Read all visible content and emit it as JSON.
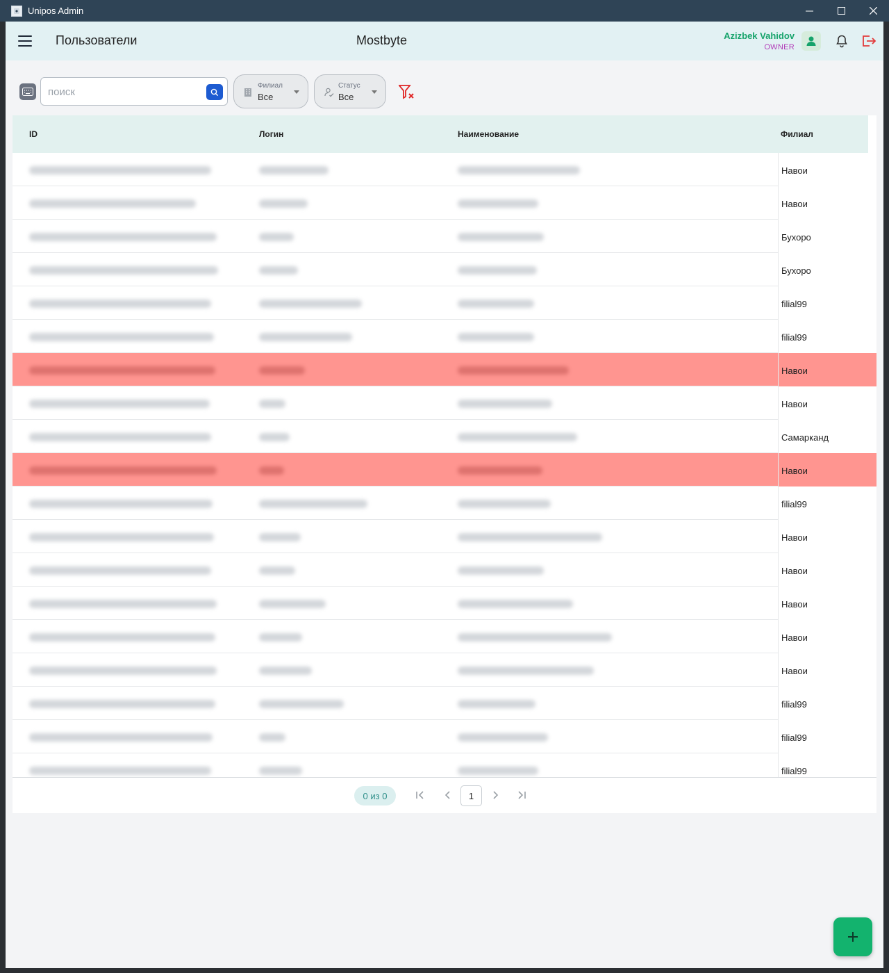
{
  "window": {
    "title": "Unipos Admin"
  },
  "header": {
    "page_title": "Пользователи",
    "company": "Mostbyte",
    "user_name": "Azizbek Vahidov",
    "user_role": "OWNER"
  },
  "toolbar": {
    "search_placeholder": "поиск",
    "branch_filter": {
      "label": "Филиал",
      "value": "Все"
    },
    "status_filter": {
      "label": "Статус",
      "value": "Все"
    }
  },
  "table": {
    "columns": [
      "ID",
      "Логин",
      "Наименование",
      "Филиал"
    ],
    "rows": [
      {
        "branch": "Навои",
        "highlighted": false
      },
      {
        "branch": "Навои",
        "highlighted": false
      },
      {
        "branch": "Бухоро",
        "highlighted": false
      },
      {
        "branch": "Бухоро",
        "highlighted": false
      },
      {
        "branch": "filial99",
        "highlighted": false
      },
      {
        "branch": "filial99",
        "highlighted": false
      },
      {
        "branch": "Навои",
        "highlighted": true
      },
      {
        "branch": "Навои",
        "highlighted": false
      },
      {
        "branch": "Самарканд",
        "highlighted": false
      },
      {
        "branch": "Навои",
        "highlighted": true
      },
      {
        "branch": "filial99",
        "highlighted": false
      },
      {
        "branch": "Навои",
        "highlighted": false
      },
      {
        "branch": "Навои",
        "highlighted": false
      },
      {
        "branch": "Навои",
        "highlighted": false
      },
      {
        "branch": "Навои",
        "highlighted": false
      },
      {
        "branch": "Навои",
        "highlighted": false
      },
      {
        "branch": "filial99",
        "highlighted": false
      },
      {
        "branch": "filial99",
        "highlighted": false
      },
      {
        "branch": "filial99",
        "highlighted": false
      }
    ]
  },
  "pagination": {
    "count": "0 из 0",
    "current_page": "1"
  },
  "colors": {
    "accent": "#13b36e",
    "highlight_row": "#ff9590",
    "header_bg": "#e2f1f3"
  },
  "icons": [
    "app-icon",
    "menu-icon",
    "user-icon",
    "bell-icon",
    "logout-icon",
    "keyboard-icon",
    "search-icon",
    "building-icon",
    "status-icon",
    "filter-clear-icon",
    "first-page-icon",
    "prev-page-icon",
    "next-page-icon",
    "last-page-icon",
    "plus-icon"
  ]
}
